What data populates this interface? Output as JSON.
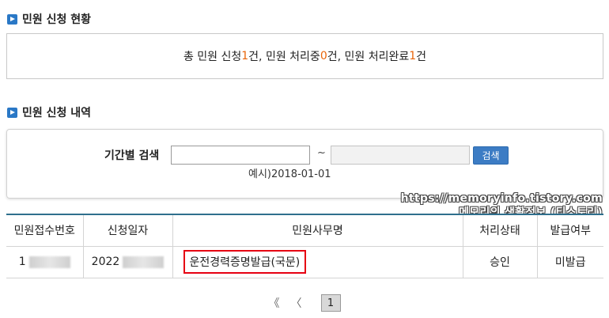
{
  "section1": {
    "title": "민원 신청 현황"
  },
  "summary": {
    "prefix": "총 민원 신청 ",
    "total": "1",
    "total_suffix": "건, 민원 처리중 ",
    "processing": "0",
    "processing_suffix": "건, 민원 처리완료 ",
    "done": "1",
    "done_suffix": "건"
  },
  "section2": {
    "title": "민원 신청 내역"
  },
  "search": {
    "label": "기간별 검색",
    "from_value": "",
    "to_value": "",
    "tilde": "~",
    "button_label": "검색",
    "example": "예시)2018-01-01"
  },
  "watermark": {
    "line1": "https://memoryinfo.tistory.com",
    "line2": "메모리의 생활정보 (티스토리)"
  },
  "table": {
    "headers": [
      "민원접수번호",
      "신청일자",
      "민원사무명",
      "처리상태",
      "발급여부"
    ],
    "rows": [
      {
        "receipt_no": "1",
        "date": "2022",
        "name": "운전경력증명발급(국문)",
        "status": "승인",
        "issued": "미발급"
      }
    ]
  },
  "pager": {
    "first": "《",
    "prev": "〈",
    "current": "1"
  },
  "colors": {
    "accent": "#2a78c6",
    "count": "#e8650a",
    "highlight": "#e60012",
    "table_border": "#2f6f8d"
  }
}
